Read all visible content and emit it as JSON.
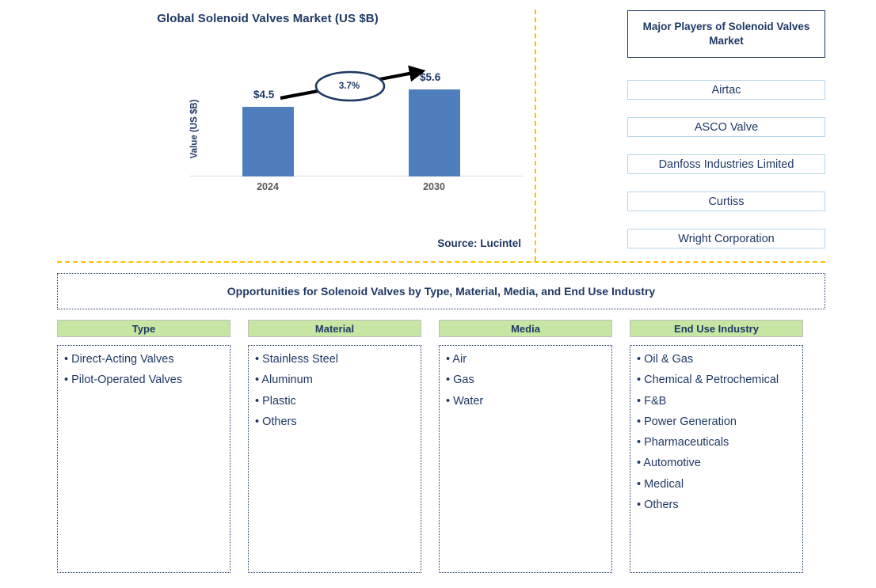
{
  "chart_data": {
    "type": "bar",
    "title": "Global Solenoid Valves Market (US $B)",
    "xlabel": "",
    "ylabel": "Value (US $B)",
    "categories": [
      "2024",
      "2030"
    ],
    "values": [
      4.5,
      5.6
    ],
    "value_labels": [
      "$4.5",
      "$5.6"
    ],
    "cagr_label": "3.7%",
    "ylim": [
      0,
      6.4
    ],
    "grid": false,
    "legend": "none",
    "bar_color": "#4E7FBC",
    "annotation": "3.7% CAGR growth arrow from 2024 bar to 2030 bar"
  },
  "chart_panel": {
    "title": "Global Solenoid Valves Market (US $B)",
    "y_axis_title": "Value (US $B)",
    "source": "Source: Lucintel"
  },
  "players_panel": {
    "header": "Major Players of Solenoid Valves Market",
    "items": [
      {
        "name": "Airtac"
      },
      {
        "name": "ASCO Valve"
      },
      {
        "name": "Danfoss Industries Limited"
      },
      {
        "name": "Curtiss"
      },
      {
        "name": "Wright Corporation"
      }
    ]
  },
  "opportunities": {
    "banner": "Opportunities for Solenoid Valves by Type, Material, Media, and End Use Industry",
    "columns": [
      {
        "header": "Type",
        "items": [
          "Direct-Acting Valves",
          "Pilot-Operated Valves"
        ]
      },
      {
        "header": "Material",
        "items": [
          "Stainless Steel",
          "Aluminum",
          "Plastic",
          "Others"
        ]
      },
      {
        "header": "Media",
        "items": [
          "Air",
          "Gas",
          "Water"
        ]
      },
      {
        "header": "End Use Industry",
        "items": [
          "Oil & Gas",
          "Chemical & Petrochemical",
          "F&B",
          "Power Generation",
          "Pharmaceuticals",
          "Automotive",
          "Medical",
          "Others"
        ]
      }
    ]
  },
  "colors": {
    "navy": "#1F3864",
    "bar_blue": "#4E7FBC",
    "divider_yellow": "#FFC000",
    "header_green": "#C7E5A3",
    "player_border": "#B8D6EA"
  }
}
